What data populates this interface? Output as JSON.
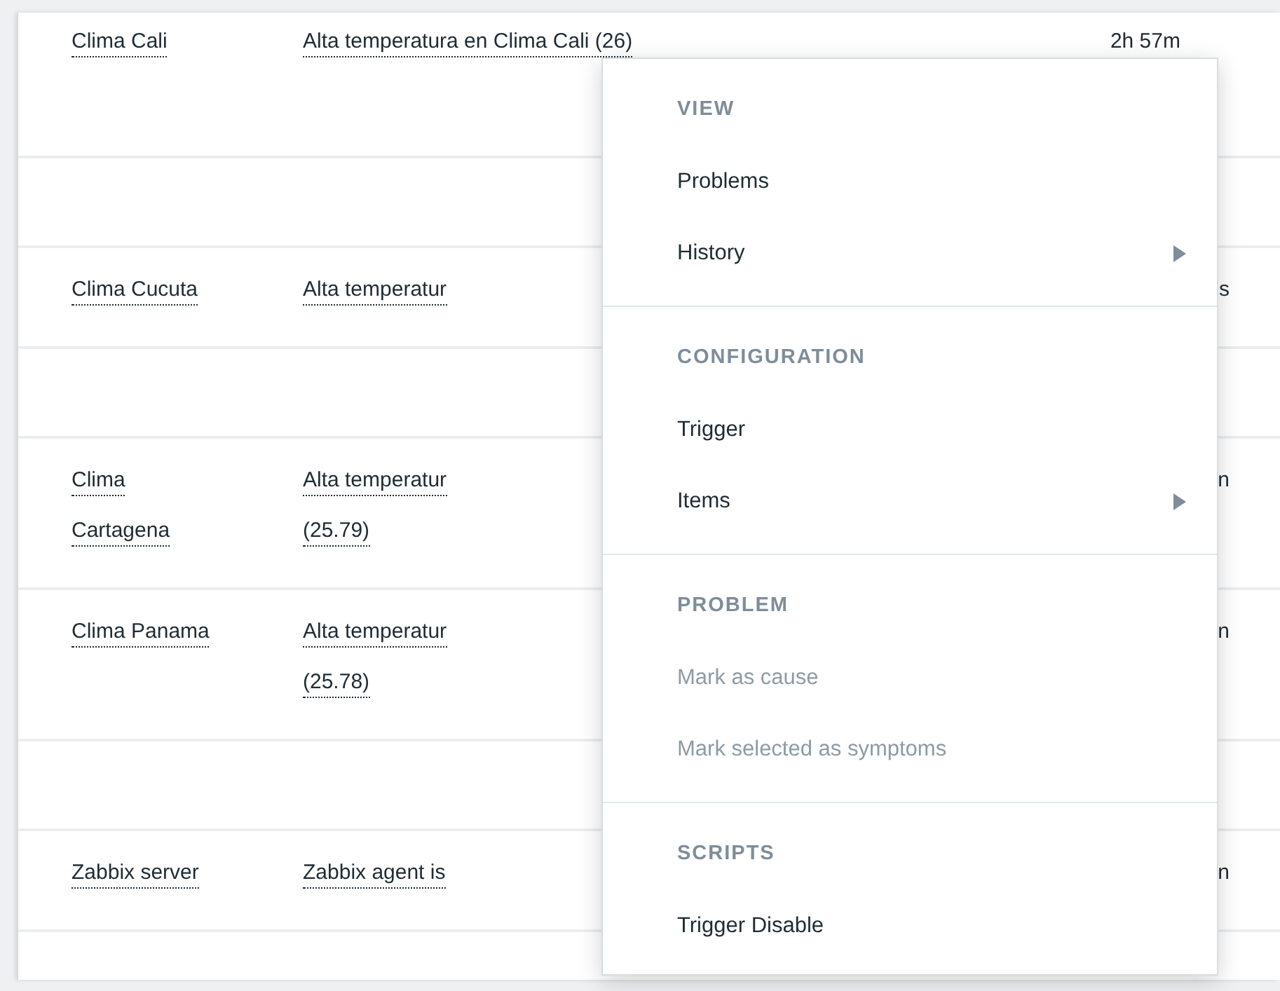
{
  "table": {
    "rows": [
      {
        "kind": "problem",
        "host": [
          "Clima Cali"
        ],
        "problem": [
          "Alta temperatura en Clima Cali (26)"
        ],
        "duration": "2h 57m"
      },
      {
        "kind": "blank"
      },
      {
        "kind": "problem",
        "host": [
          "Clima Cucuta"
        ],
        "problem": [
          "Alta temperatur"
        ],
        "duration": "s"
      },
      {
        "kind": "blank"
      },
      {
        "kind": "problem",
        "host": [
          "Clima",
          "Cartagena"
        ],
        "problem": [
          "Alta temperatur",
          "(25.79)"
        ],
        "duration": "n"
      },
      {
        "kind": "problem",
        "host": [
          "Clima Panama"
        ],
        "problem": [
          "Alta temperatur",
          "(25.78)"
        ],
        "duration": "n"
      },
      {
        "kind": "blank"
      },
      {
        "kind": "problem",
        "host": [
          "Zabbix server"
        ],
        "problem": [
          "Zabbix agent is"
        ],
        "duration": "n"
      },
      {
        "kind": "blank"
      }
    ]
  },
  "context_menu": {
    "sections": [
      {
        "header": "VIEW",
        "items": [
          {
            "label": "Problems",
            "disabled": false,
            "submenu": false
          },
          {
            "label": "History",
            "disabled": false,
            "submenu": true
          }
        ]
      },
      {
        "header": "CONFIGURATION",
        "items": [
          {
            "label": "Trigger",
            "disabled": false,
            "submenu": false
          },
          {
            "label": "Items",
            "disabled": false,
            "submenu": true
          }
        ]
      },
      {
        "header": "PROBLEM",
        "items": [
          {
            "label": "Mark as cause",
            "disabled": true,
            "submenu": false
          },
          {
            "label": "Mark selected as symptoms",
            "disabled": true,
            "submenu": false
          }
        ]
      },
      {
        "header": "SCRIPTS",
        "items": [
          {
            "label": "Trigger Disable",
            "disabled": false,
            "submenu": false
          }
        ]
      }
    ]
  }
}
